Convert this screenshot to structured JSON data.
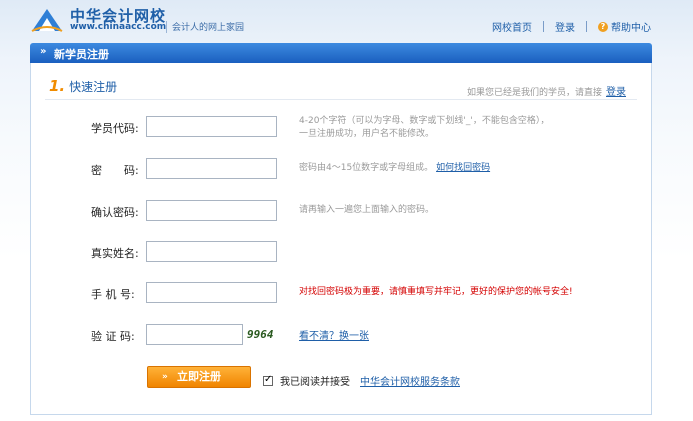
{
  "header": {
    "logo_cn": "中华会计网校",
    "logo_en": "www.chinaacc.com",
    "slogan": "会计人的网上家园",
    "nav": {
      "home": "网校首页",
      "login": "登录",
      "help": "帮助中心"
    }
  },
  "bar": {
    "title": "新学员注册"
  },
  "section": {
    "number": "1.",
    "title": "快速注册",
    "login_hint": "如果您已经是我们的学员，请直接",
    "login_link": "登录"
  },
  "form": {
    "student_id": {
      "label": "学员代码:",
      "hint_line1": "4-20个字符（可以为字母、数字或下划线'_'，不能包含空格），",
      "hint_line2": "一旦注册成功，用户名不能修改。"
    },
    "password": {
      "label": "密　　码:",
      "hint": "密码由4～15位数字或字母组成。",
      "hint_link": "如何找回密码"
    },
    "confirm_password": {
      "label": "确认密码:",
      "hint": "请再输入一遍您上面输入的密码。"
    },
    "real_name": {
      "label": "真实姓名:"
    },
    "phone": {
      "label": "手 机 号:",
      "hint": "对找回密码极为重要，请慎重填写并牢记，更好的保护您的帐号安全!"
    },
    "captcha": {
      "label": "验 证 码:",
      "code": "9964",
      "refresh_link": "看不清？换一张"
    },
    "submit_label": "立即注册",
    "agree_text": "我已阅读并接受",
    "agree_link": "中华会计网校服务条款",
    "agree_checked": true
  },
  "colors": {
    "brand_blue": "#1f5fa8",
    "bar_blue": "#1a5fbf",
    "accent_orange": "#f08400",
    "warning_red": "#d40000"
  }
}
